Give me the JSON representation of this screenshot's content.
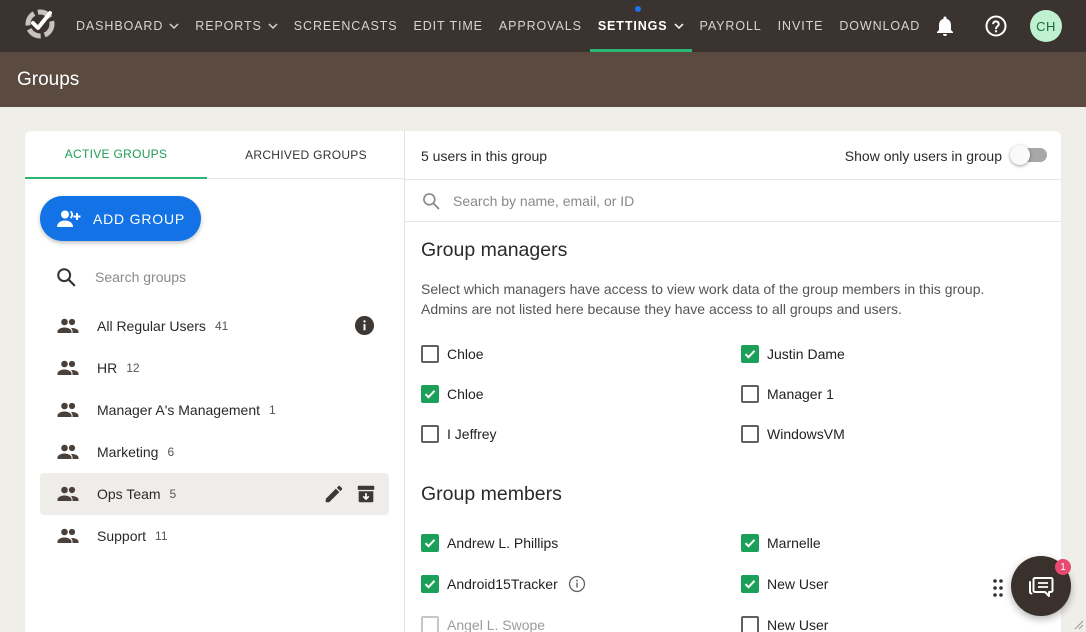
{
  "nav": {
    "items": [
      {
        "label": "DASHBOARD",
        "dropdown": true,
        "active": false
      },
      {
        "label": "REPORTS",
        "dropdown": true,
        "active": false
      },
      {
        "label": "SCREENCASTS",
        "dropdown": false,
        "active": false
      },
      {
        "label": "EDIT TIME",
        "dropdown": false,
        "active": false
      },
      {
        "label": "APPROVALS",
        "dropdown": false,
        "active": false
      },
      {
        "label": "SETTINGS",
        "dropdown": true,
        "active": true
      },
      {
        "label": "PAYROLL",
        "dropdown": false,
        "active": false
      },
      {
        "label": "INVITE",
        "dropdown": false,
        "active": false
      },
      {
        "label": "DOWNLOAD",
        "dropdown": false,
        "active": false
      }
    ],
    "avatar_initials": "CH",
    "icons": [
      "logo-icon",
      "bell-icon",
      "help-icon"
    ]
  },
  "page": {
    "title": "Groups"
  },
  "left": {
    "tabs": [
      {
        "label": "ACTIVE GROUPS",
        "active": true
      },
      {
        "label": "ARCHIVED GROUPS",
        "active": false
      }
    ],
    "add_button": "ADD GROUP",
    "search_placeholder": "Search groups",
    "groups": [
      {
        "name": "All Regular Users",
        "count": "41"
      },
      {
        "name": "HR",
        "count": "12"
      },
      {
        "name": "Manager A's Management",
        "count": "1"
      },
      {
        "name": "Marketing",
        "count": "6"
      },
      {
        "name": "Ops Team",
        "count": "5"
      },
      {
        "name": "Support",
        "count": "11"
      }
    ]
  },
  "right": {
    "user_count": "5 users in this group",
    "toggle_label": "Show only users in group",
    "search_placeholder": "Search by name, email, or ID",
    "managers_title": "Group managers",
    "managers_desc": "Select which managers have access to view work data of the group members in this group. Admins are not listed here because they have access to all groups and users.",
    "managers": [
      {
        "name": "Chloe",
        "checked": false
      },
      {
        "name": "Justin Dame",
        "checked": true
      },
      {
        "name": "Chloe",
        "checked": true
      },
      {
        "name": "Manager 1",
        "checked": false
      },
      {
        "name": "I Jeffrey",
        "checked": false
      },
      {
        "name": "WindowsVM",
        "checked": false
      }
    ],
    "members_title": "Group members",
    "members": [
      {
        "name": "Andrew L. Phillips",
        "checked": true
      },
      {
        "name": "Marnelle",
        "checked": true
      },
      {
        "name": "Android15Tracker",
        "checked": true
      },
      {
        "name": "New User",
        "checked": true
      },
      {
        "name": "Angel L. Swope",
        "checked": false
      },
      {
        "name": "New User",
        "checked": false
      }
    ]
  },
  "chat": {
    "badge": "1"
  },
  "colors": {
    "accent_green": "#2bb673",
    "primary_blue": "#1373e6",
    "nav_bg": "#3a3330",
    "header_bg": "#5a4a40"
  }
}
